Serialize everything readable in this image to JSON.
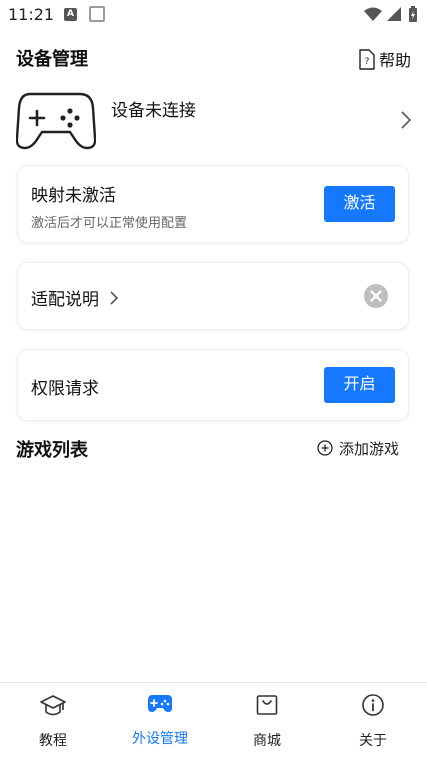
{
  "status_bar": {
    "time": "11:21",
    "notif_letter": "A"
  },
  "header": {
    "title": "设备管理",
    "help_label": "帮助"
  },
  "device": {
    "status": "设备未连接"
  },
  "activation_card": {
    "title": "映射未激活",
    "subtitle": "激活后才可以正常使用配置",
    "button": "激活"
  },
  "adapt_card": {
    "label": "适配说明"
  },
  "permission_card": {
    "title": "权限请求",
    "button": "开启"
  },
  "games": {
    "title": "游戏列表",
    "add_label": "添加游戏"
  },
  "bottom_nav": {
    "items": [
      {
        "label": "教程",
        "icon": "graduation-cap-icon",
        "active": false
      },
      {
        "label": "外设管理",
        "icon": "gamepad-icon",
        "active": true
      },
      {
        "label": "商城",
        "icon": "shopping-bag-icon",
        "active": false
      },
      {
        "label": "关于",
        "icon": "info-icon",
        "active": false
      }
    ]
  },
  "colors": {
    "accent": "#1677ff",
    "text": "#111111",
    "subtext": "#666666",
    "close_gray": "#bdbdbd"
  }
}
